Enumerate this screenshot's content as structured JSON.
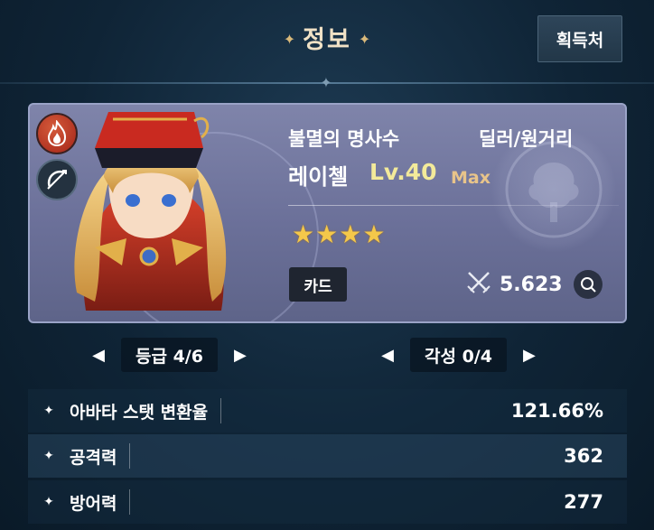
{
  "header": {
    "title": "정보",
    "source_button": "획득처"
  },
  "card": {
    "title": "불멸의 명사수",
    "role": "딜러/원거리",
    "name": "레이첼",
    "level": "Lv.40",
    "max": "Max",
    "stars": 4,
    "card_badge": "카드",
    "power": "5.623",
    "element_icon": "fire-icon",
    "class_icon": "bow-icon"
  },
  "selectors": {
    "grade": "등급 4/6",
    "awaken": "각성 0/4"
  },
  "stats": [
    {
      "label": "아바타 스탯 변환율",
      "value": "121.66%"
    },
    {
      "label": "공격력",
      "value": "362"
    },
    {
      "label": "방어력",
      "value": "277"
    }
  ],
  "colors": {
    "title": "#f1e2c6",
    "level": "#f3ea9a",
    "star": "#f4c84a",
    "card_bg": "#7076a0"
  }
}
